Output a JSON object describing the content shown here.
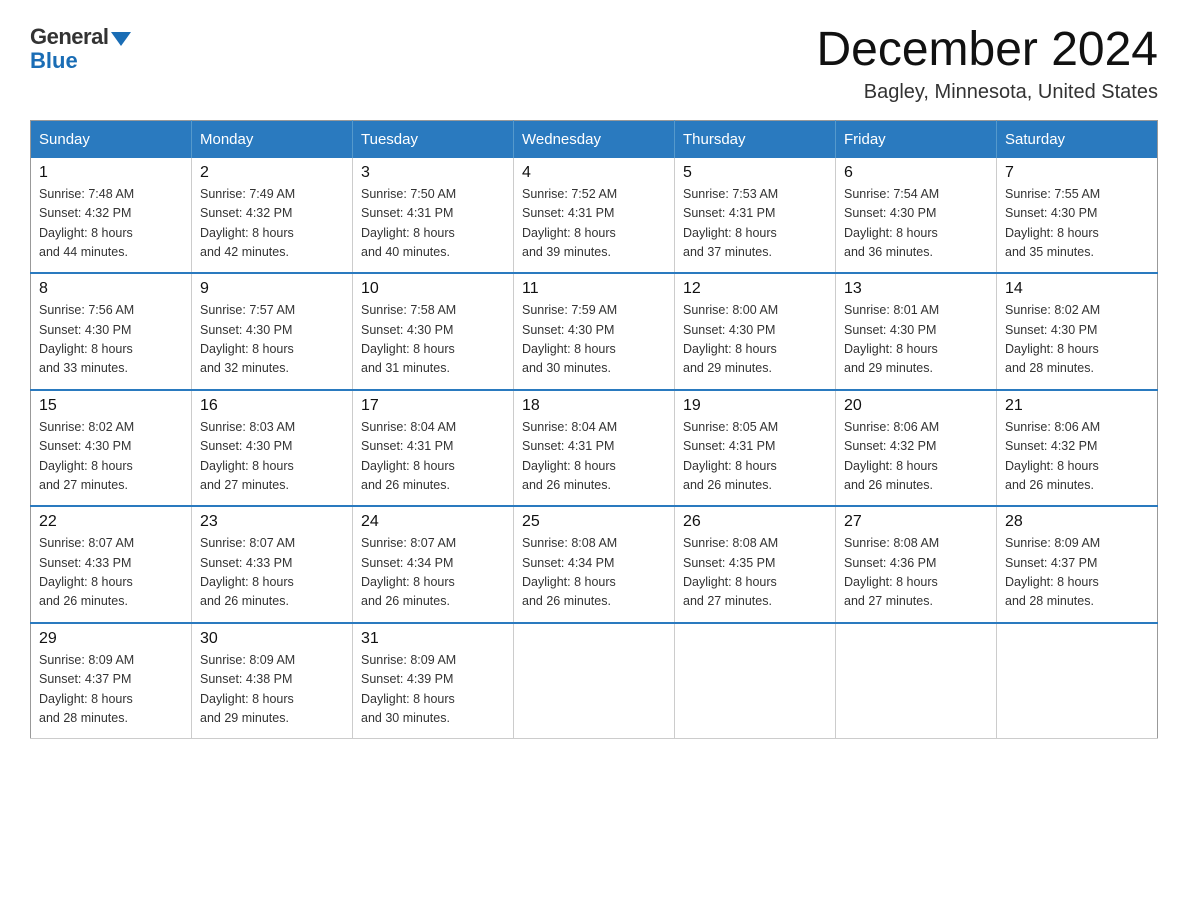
{
  "logo": {
    "general": "General",
    "blue": "Blue"
  },
  "title": "December 2024",
  "location": "Bagley, Minnesota, United States",
  "weekdays": [
    "Sunday",
    "Monday",
    "Tuesday",
    "Wednesday",
    "Thursday",
    "Friday",
    "Saturday"
  ],
  "weeks": [
    [
      {
        "day": "1",
        "sunrise": "7:48 AM",
        "sunset": "4:32 PM",
        "daylight": "8 hours and 44 minutes."
      },
      {
        "day": "2",
        "sunrise": "7:49 AM",
        "sunset": "4:32 PM",
        "daylight": "8 hours and 42 minutes."
      },
      {
        "day": "3",
        "sunrise": "7:50 AM",
        "sunset": "4:31 PM",
        "daylight": "8 hours and 40 minutes."
      },
      {
        "day": "4",
        "sunrise": "7:52 AM",
        "sunset": "4:31 PM",
        "daylight": "8 hours and 39 minutes."
      },
      {
        "day": "5",
        "sunrise": "7:53 AM",
        "sunset": "4:31 PM",
        "daylight": "8 hours and 37 minutes."
      },
      {
        "day": "6",
        "sunrise": "7:54 AM",
        "sunset": "4:30 PM",
        "daylight": "8 hours and 36 minutes."
      },
      {
        "day": "7",
        "sunrise": "7:55 AM",
        "sunset": "4:30 PM",
        "daylight": "8 hours and 35 minutes."
      }
    ],
    [
      {
        "day": "8",
        "sunrise": "7:56 AM",
        "sunset": "4:30 PM",
        "daylight": "8 hours and 33 minutes."
      },
      {
        "day": "9",
        "sunrise": "7:57 AM",
        "sunset": "4:30 PM",
        "daylight": "8 hours and 32 minutes."
      },
      {
        "day": "10",
        "sunrise": "7:58 AM",
        "sunset": "4:30 PM",
        "daylight": "8 hours and 31 minutes."
      },
      {
        "day": "11",
        "sunrise": "7:59 AM",
        "sunset": "4:30 PM",
        "daylight": "8 hours and 30 minutes."
      },
      {
        "day": "12",
        "sunrise": "8:00 AM",
        "sunset": "4:30 PM",
        "daylight": "8 hours and 29 minutes."
      },
      {
        "day": "13",
        "sunrise": "8:01 AM",
        "sunset": "4:30 PM",
        "daylight": "8 hours and 29 minutes."
      },
      {
        "day": "14",
        "sunrise": "8:02 AM",
        "sunset": "4:30 PM",
        "daylight": "8 hours and 28 minutes."
      }
    ],
    [
      {
        "day": "15",
        "sunrise": "8:02 AM",
        "sunset": "4:30 PM",
        "daylight": "8 hours and 27 minutes."
      },
      {
        "day": "16",
        "sunrise": "8:03 AM",
        "sunset": "4:30 PM",
        "daylight": "8 hours and 27 minutes."
      },
      {
        "day": "17",
        "sunrise": "8:04 AM",
        "sunset": "4:31 PM",
        "daylight": "8 hours and 26 minutes."
      },
      {
        "day": "18",
        "sunrise": "8:04 AM",
        "sunset": "4:31 PM",
        "daylight": "8 hours and 26 minutes."
      },
      {
        "day": "19",
        "sunrise": "8:05 AM",
        "sunset": "4:31 PM",
        "daylight": "8 hours and 26 minutes."
      },
      {
        "day": "20",
        "sunrise": "8:06 AM",
        "sunset": "4:32 PM",
        "daylight": "8 hours and 26 minutes."
      },
      {
        "day": "21",
        "sunrise": "8:06 AM",
        "sunset": "4:32 PM",
        "daylight": "8 hours and 26 minutes."
      }
    ],
    [
      {
        "day": "22",
        "sunrise": "8:07 AM",
        "sunset": "4:33 PM",
        "daylight": "8 hours and 26 minutes."
      },
      {
        "day": "23",
        "sunrise": "8:07 AM",
        "sunset": "4:33 PM",
        "daylight": "8 hours and 26 minutes."
      },
      {
        "day": "24",
        "sunrise": "8:07 AM",
        "sunset": "4:34 PM",
        "daylight": "8 hours and 26 minutes."
      },
      {
        "day": "25",
        "sunrise": "8:08 AM",
        "sunset": "4:34 PM",
        "daylight": "8 hours and 26 minutes."
      },
      {
        "day": "26",
        "sunrise": "8:08 AM",
        "sunset": "4:35 PM",
        "daylight": "8 hours and 27 minutes."
      },
      {
        "day": "27",
        "sunrise": "8:08 AM",
        "sunset": "4:36 PM",
        "daylight": "8 hours and 27 minutes."
      },
      {
        "day": "28",
        "sunrise": "8:09 AM",
        "sunset": "4:37 PM",
        "daylight": "8 hours and 28 minutes."
      }
    ],
    [
      {
        "day": "29",
        "sunrise": "8:09 AM",
        "sunset": "4:37 PM",
        "daylight": "8 hours and 28 minutes."
      },
      {
        "day": "30",
        "sunrise": "8:09 AM",
        "sunset": "4:38 PM",
        "daylight": "8 hours and 29 minutes."
      },
      {
        "day": "31",
        "sunrise": "8:09 AM",
        "sunset": "4:39 PM",
        "daylight": "8 hours and 30 minutes."
      },
      null,
      null,
      null,
      null
    ]
  ],
  "labels": {
    "sunrise": "Sunrise:",
    "sunset": "Sunset:",
    "daylight": "Daylight:"
  }
}
